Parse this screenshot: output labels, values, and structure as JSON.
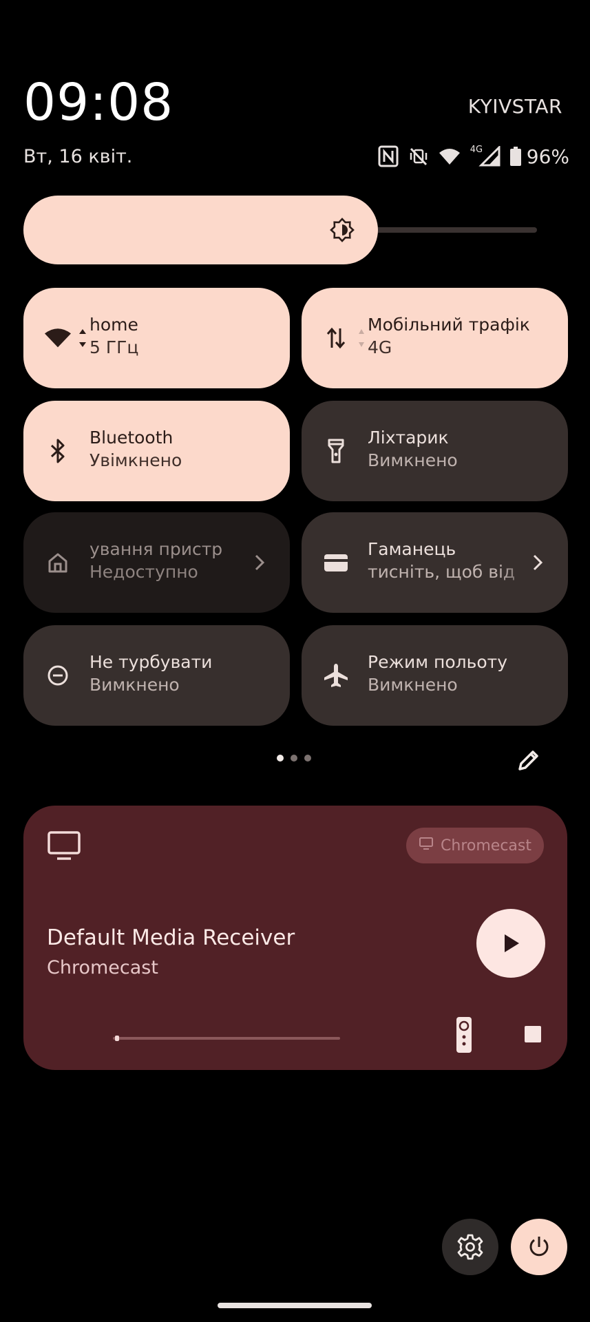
{
  "status": {
    "time": "09:08",
    "date": "Вт, 16 квіт.",
    "carrier": "KYIVSTAR",
    "network_label": "4G",
    "battery": "96%"
  },
  "brightness": {
    "level": 0.69
  },
  "tiles": [
    {
      "label": "home",
      "sub": "5 ГГц",
      "state": "on",
      "icon": "wifi-icon"
    },
    {
      "label": "Мобільний трафік",
      "sub": "4G",
      "state": "on",
      "icon": "mobile-data-icon"
    },
    {
      "label": "Bluetooth",
      "sub": "Увімкнено",
      "state": "on",
      "icon": "bluetooth-icon"
    },
    {
      "label": "Ліхтарик",
      "sub": "Вимкнено",
      "state": "off",
      "icon": "flashlight-icon"
    },
    {
      "label": "ування пристр",
      "sub": "Недоступно",
      "state": "unavailable",
      "icon": "home-icon"
    },
    {
      "label": "Гаманець",
      "sub": "тисніть, щоб від",
      "state": "off",
      "icon": "wallet-icon"
    },
    {
      "label": "Не турбувати",
      "sub": "Вимкнено",
      "state": "off",
      "icon": "do-not-disturb-icon"
    },
    {
      "label": "Режим польоту",
      "sub": "Вимкнено",
      "state": "off",
      "icon": "airplane-icon"
    }
  ],
  "pager": {
    "pages": 3,
    "current": 1
  },
  "media": {
    "device_chip": "Chromecast",
    "title": "Default Media Receiver",
    "subtitle": "Chromecast",
    "progress": 0.01
  },
  "colors": {
    "tile_on": "#fcd9cb",
    "tile_off": "#372f2d",
    "media_bg": "#512126"
  }
}
